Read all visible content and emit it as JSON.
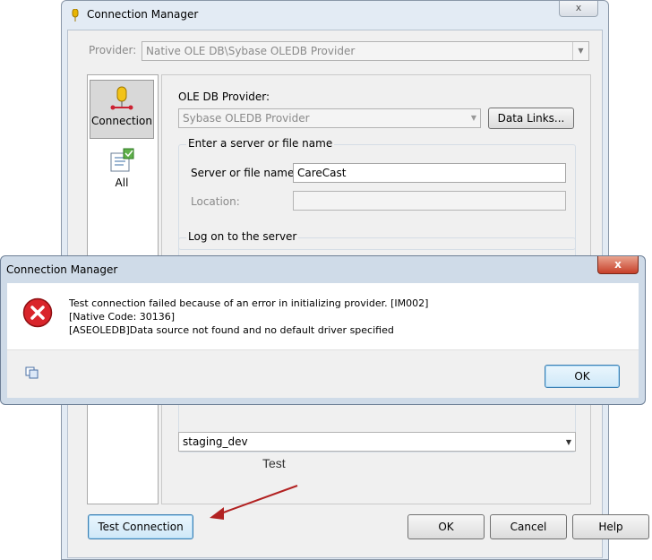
{
  "window": {
    "title": "Connection Manager",
    "close_label": "x",
    "provider_label": "Provider:",
    "provider_value": "Native OLE DB\\Sybase OLEDB Provider",
    "nav": [
      {
        "label": "Connection"
      },
      {
        "label": "All"
      }
    ],
    "oledb_label": "OLE DB Provider:",
    "oledb_value": "Sybase OLEDB Provider",
    "data_links_label": "Data Links...",
    "server_group_title": "Enter a server or file name",
    "server_label": "Server or file name:",
    "server_value": "CareCast",
    "location_label": "Location:",
    "location_value": "",
    "logon_group_title": "Log on to the server",
    "database_value": "staging_dev",
    "test_connection_label": "Test Connection",
    "ok_label": "OK",
    "cancel_label": "Cancel",
    "help_label": "Help"
  },
  "annotation": {
    "text": "Test"
  },
  "error_dialog": {
    "title": "Connection Manager",
    "close_label": "x",
    "messages": [
      "Test connection failed because of an error in initializing provider. [IM002]",
      "[Native Code: 30136]",
      "[ASEOLEDB]Data source not found and no default driver specified"
    ],
    "ok_label": "OK"
  },
  "colors": {
    "window_frame": "#e3ebf4",
    "dialog_frame": "#cfdbe8",
    "close_red": "#c7402a",
    "arrow": "#b22222",
    "error_icon": "#d9252b"
  }
}
